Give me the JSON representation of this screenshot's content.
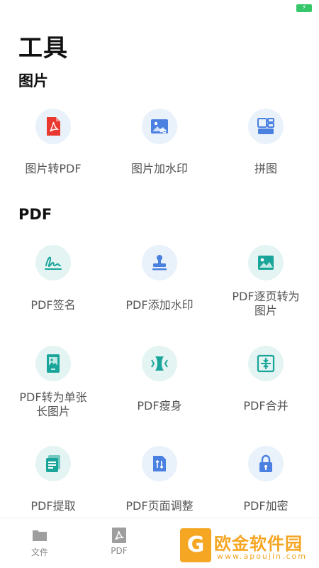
{
  "app": {
    "page_title": "工具"
  },
  "status_bar": {
    "battery_icon": "battery-charging-icon",
    "battery_color": "#36c76a"
  },
  "sections": [
    {
      "title": "图片",
      "tools": [
        {
          "label": "图片转PDF",
          "icon": "pdf-file-icon"
        },
        {
          "label": "图片加水印",
          "icon": "image-watermark-icon"
        },
        {
          "label": "拼图",
          "icon": "collage-icon"
        }
      ]
    },
    {
      "title": "PDF",
      "tools": [
        {
          "label": "PDF签名",
          "icon": "signature-icon"
        },
        {
          "label": "PDF添加水印",
          "icon": "stamp-icon"
        },
        {
          "label": "PDF逐页转为\n图片",
          "icon": "image-icon"
        },
        {
          "label": "PDF转为单张\n长图片",
          "icon": "long-image-icon"
        },
        {
          "label": "PDF瘦身",
          "icon": "compress-icon"
        },
        {
          "label": "PDF合并",
          "icon": "merge-icon"
        },
        {
          "label": "PDF提取",
          "icon": "extract-icon"
        },
        {
          "label": "PDF页面调整",
          "icon": "page-adjust-icon"
        },
        {
          "label": "PDF加密",
          "icon": "lock-icon"
        }
      ]
    }
  ],
  "tabbar": {
    "tabs": [
      {
        "label": "文件",
        "icon": "folder-icon"
      },
      {
        "label": "PDF",
        "icon": "pdf-tab-icon"
      },
      {
        "label": "",
        "icon": "tools-icon"
      },
      {
        "label": "",
        "icon": "user-icon"
      }
    ]
  },
  "watermark": {
    "logo_letter": "G",
    "text": "欧金软件园",
    "url": "www.apoujin.com"
  },
  "colors": {
    "accent_blue": "#3d7be8",
    "accent_teal": "#1aa59a",
    "pdf_red": "#e8382f",
    "watermark_orange": "#f5a623"
  }
}
